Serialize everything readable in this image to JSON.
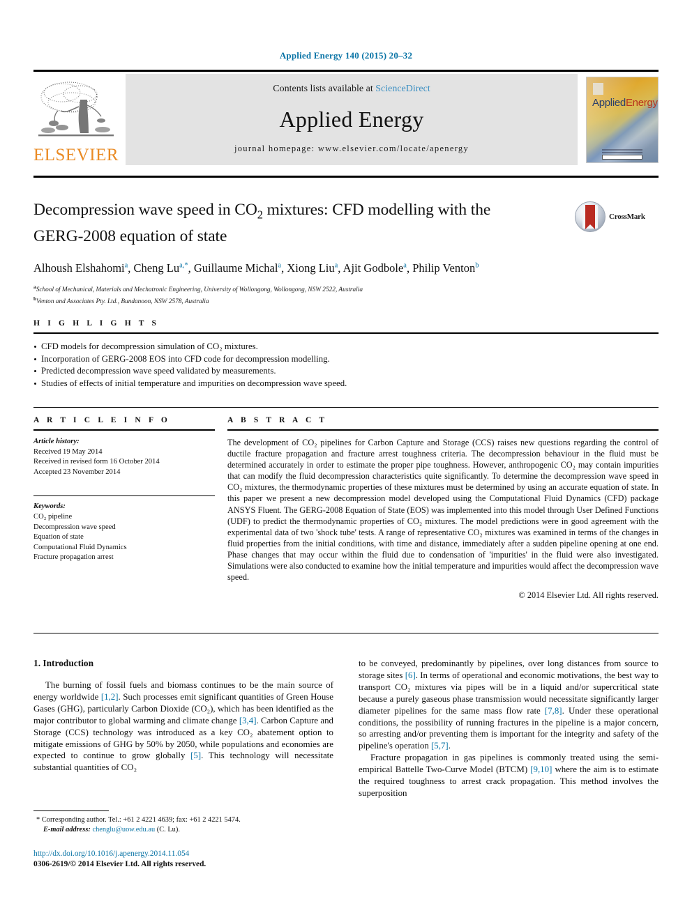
{
  "running_head": "Applied Energy 140 (2015) 20–32",
  "masthead": {
    "publisher_name": "ELSEVIER",
    "contents_prefix": "Contents lists available at ",
    "contents_link": "ScienceDirect",
    "journal_title": "Applied Energy",
    "homepage": "journal homepage: www.elsevier.com/locate/apenergy",
    "cover_title_first": "Applied",
    "cover_title_second": "Energy",
    "link_color": "#3c8fc2"
  },
  "title": {
    "line1": "Decompression wave speed in CO",
    "sub1": "2",
    "line1b": " mixtures: CFD modelling with the",
    "line2": "GERG-2008 equation of state",
    "crossmark_label": "CrossMark"
  },
  "authors": {
    "list": [
      {
        "name": "Alhoush Elshahomi",
        "sup": "a",
        "sep": ", "
      },
      {
        "name": "Cheng Lu",
        "sup": "a,*",
        "sep": ", "
      },
      {
        "name": "Guillaume Michal",
        "sup": "a",
        "sep": ", "
      },
      {
        "name": "Xiong Liu",
        "sup": "a",
        "sep": ", "
      },
      {
        "name": "Ajit Godbole",
        "sup": "a",
        "sep": ", "
      },
      {
        "name": "Philip Venton",
        "sup": "b",
        "sep": ""
      }
    ],
    "affiliations": [
      {
        "marker": "a",
        "text": "School of Mechanical, Materials and Mechatronic Engineering, University of Wollongong, Wollongong, NSW 2522, Australia"
      },
      {
        "marker": "b",
        "text": "Venton and Associates Pty. Ltd., Bundanoon, NSW 2578, Australia"
      }
    ]
  },
  "highlights": {
    "heading": "H I G H L I G H T S",
    "items": [
      "CFD models for decompression simulation of CO₂ mixtures.",
      "Incorporation of GERG-2008 EOS into CFD code for decompression modelling.",
      "Predicted decompression wave speed validated by measurements.",
      "Studies of effects of initial temperature and impurities on decompression wave speed."
    ]
  },
  "article_info": {
    "heading": "A R T I C L E    I N F O",
    "history_label": "Article history:",
    "history": [
      "Received 19 May 2014",
      "Received in revised form 16 October 2014",
      "Accepted 23 November 2014"
    ],
    "keywords_label": "Keywords:",
    "keywords": [
      "CO₂ pipeline",
      "Decompression wave speed",
      "Equation of state",
      "Computational Fluid Dynamics",
      "Fracture propagation arrest"
    ]
  },
  "abstract": {
    "heading": "A B S T R A C T",
    "text": "The development of CO₂ pipelines for Carbon Capture and Storage (CCS) raises new questions regarding the control of ductile fracture propagation and fracture arrest toughness criteria. The decompression behaviour in the fluid must be determined accurately in order to estimate the proper pipe toughness. However, anthropogenic CO₂ may contain impurities that can modify the fluid decompression characteristics quite significantly. To determine the decompression wave speed in CO₂ mixtures, the thermodynamic properties of these mixtures must be determined by using an accurate equation of state. In this paper we present a new decompression model developed using the Computational Fluid Dynamics (CFD) package ANSYS Fluent. The GERG-2008 Equation of State (EOS) was implemented into this model through User Defined Functions (UDF) to predict the thermodynamic properties of CO₂ mixtures. The model predictions were in good agreement with the experimental data of two 'shock tube' tests. A range of representative CO₂ mixtures was examined in terms of the changes in fluid properties from the initial conditions, with time and distance, immediately after a sudden pipeline opening at one end. Phase changes that may occur within the fluid due to condensation of 'impurities' in the fluid were also investigated. Simulations were also conducted to examine how the initial temperature and impurities would affect the decompression wave speed.",
    "copyright": "© 2014 Elsevier Ltd. All rights reserved."
  },
  "body": {
    "section_heading": "1. Introduction",
    "left_paragraph_1_a": "The burning of fossil fuels and biomass continues to be the main source of energy worldwide ",
    "left_ref_1": "[1,2]",
    "left_paragraph_1_b": ". Such processes emit significant quantities of Green House Gases (GHG), particularly Carbon Dioxide (CO₂), which has been identified as the major contributor to global warming and climate change ",
    "left_ref_2": "[3,4]",
    "left_paragraph_1_c": ". Carbon Capture and Storage (CCS) technology was introduced as a key CO₂ abatement option to mitigate emissions of GHG by 50% by 2050, while populations and economies are expected to continue to grow globally ",
    "left_ref_3": "[5]",
    "left_paragraph_1_d": ". This technology will necessitate substantial quantities of CO₂",
    "right_paragraph_1_a": "to be conveyed, predominantly by pipelines, over long distances from source to storage sites ",
    "right_ref_1": "[6]",
    "right_paragraph_1_b": ". In terms of operational and economic motivations, the best way to transport CO₂ mixtures via pipes will be in a liquid and/or supercritical state because a purely gaseous phase transmission would necessitate significantly larger diameter pipelines for the same mass flow rate ",
    "right_ref_2": "[7,8]",
    "right_paragraph_1_c": ". Under these operational conditions, the possibility of running fractures in the pipeline is a major concern, so arresting and/or preventing them is important for the integrity and safety of the pipeline's operation ",
    "right_ref_3": "[5,7]",
    "right_paragraph_1_d": ".",
    "right_paragraph_2_a": "Fracture propagation in gas pipelines is commonly treated using the semi-empirical Battelle Two-Curve Model (BTCM) ",
    "right_ref_4": "[9,10]",
    "right_paragraph_2_b": " where the aim is to estimate the required toughness to arrest crack propagation. This method involves the superposition"
  },
  "footnote": {
    "marker": "*",
    "line1": "Corresponding author. Tel.: +61 2 4221 4639; fax: +61 2 4221 5474.",
    "email_label": "E-mail address:",
    "email": "chenglu@uow.edu.au",
    "email_suffix": "(C. Lu)."
  },
  "page_footer": {
    "doi": "http://dx.doi.org/10.1016/j.apenergy.2014.11.054",
    "issn_copyright": "0306-2619/© 2014 Elsevier Ltd. All rights reserved."
  }
}
